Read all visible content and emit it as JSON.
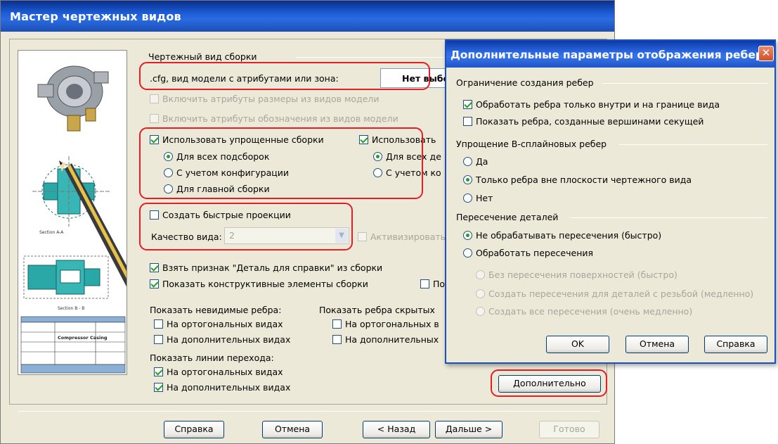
{
  "wizard_title": "Мастер чертежных видов",
  "preview": {
    "caption": "Compressor Casing",
    "section_a": "Section A-A",
    "section_b": "Section B - B"
  },
  "main": {
    "assembly_group": "Чертежный вид сборки",
    "cfg_label": ".cfg, вид модели с атрибутами или зона:",
    "cfg_value": "Нет выбо",
    "cb_dim_attrs": "Включить атрибуты размеры из видов модели",
    "cb_note_attrs": "Включить атрибуты обозначения из видов модели",
    "cb_simplified": "Использовать упрощенные сборки",
    "rb_all_sub": "Для всех подсборок",
    "rb_config": "С учетом конфигурации",
    "rb_main": "Для главной сборки",
    "cb_use2": "Использовать",
    "rb_all2": "Для всех де",
    "rb_config2": "С учетом ко",
    "cb_fast": "Создать быстрые проекции",
    "quality_label": "Качество вида:",
    "quality_value": "2",
    "cb_activate": "Активизировать",
    "cb_ref_part": "Взять признак \"Деталь для справки\" из сборки",
    "cb_show_features": "Показать конструктивные элементы сборки",
    "cb_p": "По",
    "hidden_group": "Показать невидимые ребра:",
    "hidden_ortho": "На ортогональных видах",
    "hidden_aux": "На дополнительных видах",
    "hidden2_group": "Показать ребра скрытых",
    "hidden2_ortho": "На ортогональных в",
    "hidden2_aux": "На дополнительных",
    "trans_group": "Показать линии перехода:",
    "trans_ortho": "На ортогональных видах",
    "trans_aux": "На дополнительных видах",
    "more_button": "Дополнительно"
  },
  "footer": {
    "help": "Справка",
    "cancel": "Отмена",
    "back": "< Назад",
    "next": "Дальше >",
    "finish": "Готово"
  },
  "edges_dialog": {
    "title": "Дополнительные параметры отображения ребер",
    "limit_group": "Ограничение создания ребер",
    "cb_inside": "Обработать ребра только внутри и на границе вида",
    "cb_section": "Показать ребра, созданные вершинами секущей",
    "bspline_group": "Упрощение B-сплайновых ребер",
    "rb_yes": "Да",
    "rb_outside": "Только ребра вне плоскости чертежного вида",
    "rb_no": "Нет",
    "intersect_group": "Пересечение деталей",
    "rb_no_process": "Не обрабатывать пересечения (быстро)",
    "rb_process": "Обработать пересечения",
    "rb_no_surface": "Без пересечения поверхностей (быстро)",
    "rb_thread": "Создать пересечения для деталей с резьбой (медленно)",
    "rb_all": "Создать все пересечения (очень медленно)",
    "ok": "OK",
    "cancel": "Отмена",
    "help": "Справка"
  },
  "colors": {
    "highlight": "#e31e24",
    "title_bar": "#1d5cd6",
    "dialog_bg": "#ece9d8"
  }
}
